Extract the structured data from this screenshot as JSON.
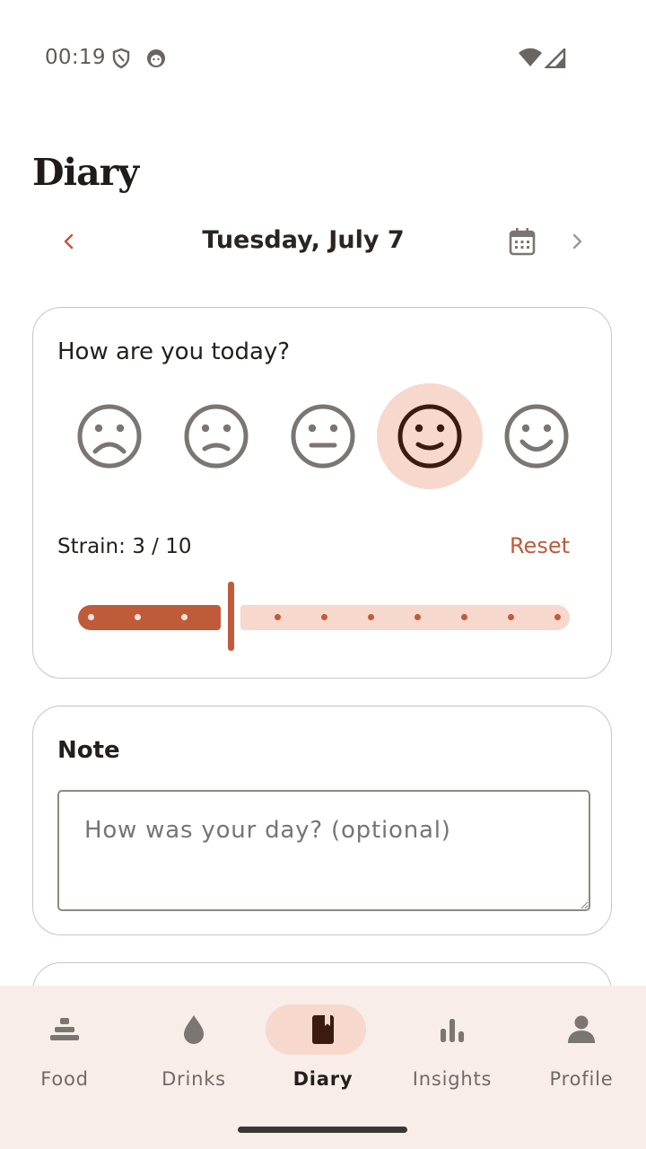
{
  "status_bar": {
    "time": "00:19"
  },
  "header": {
    "title": "Diary"
  },
  "date_nav": {
    "date": "Tuesday, July 7"
  },
  "mood": {
    "question": "How are you today?",
    "options": [
      "very-sad",
      "sad",
      "neutral",
      "happy",
      "very-happy"
    ],
    "selected_index": 3
  },
  "strain": {
    "label": "Strain: 3 / 10",
    "value": 3,
    "max": 10,
    "reset_label": "Reset"
  },
  "note": {
    "heading": "Note",
    "placeholder": "How was your day? (optional)",
    "value": ""
  },
  "bottom_nav": {
    "items": [
      {
        "label": "Food",
        "icon": "food-icon"
      },
      {
        "label": "Drinks",
        "icon": "drop-icon"
      },
      {
        "label": "Diary",
        "icon": "diary-book-icon"
      },
      {
        "label": "Insights",
        "icon": "bar-chart-icon"
      },
      {
        "label": "Profile",
        "icon": "person-icon"
      }
    ],
    "active_index": 2
  },
  "colors": {
    "accent": "#c05b3a",
    "accent_light": "#f6d8cc",
    "nav_background": "#f8ede9",
    "icon_gray": "#7b7672"
  }
}
